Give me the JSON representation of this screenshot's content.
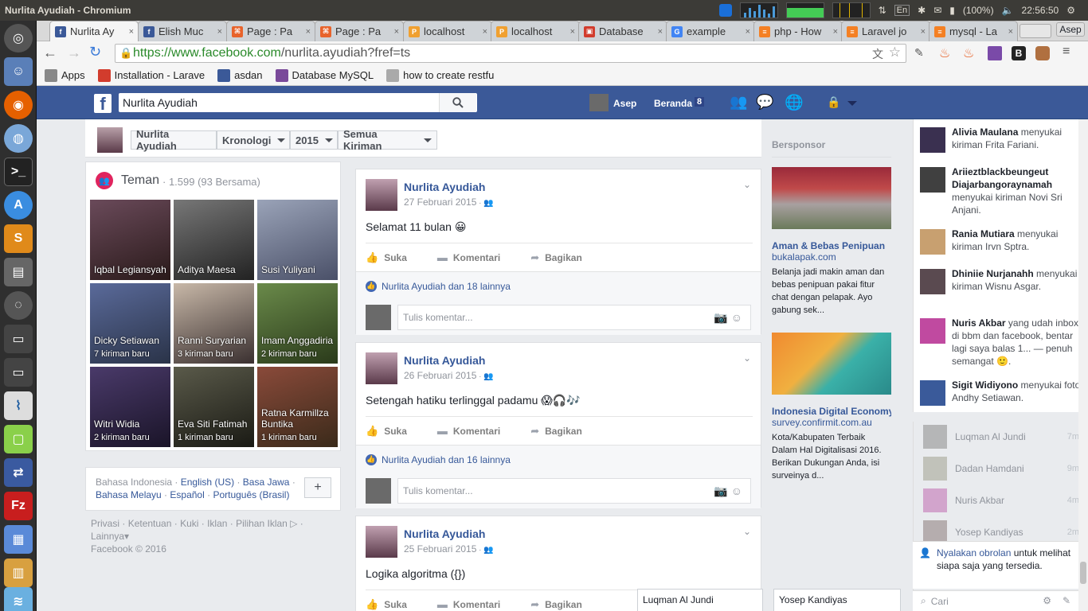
{
  "window": {
    "title": "Nurlita Ayudiah - Chromium"
  },
  "tray": {
    "battery": "(100%)",
    "clock": "22:56:50",
    "lang": "En"
  },
  "tabs": [
    {
      "label": "Nurlita Ay",
      "icon": "facebook",
      "color": "#3b5998",
      "glyph": "f"
    },
    {
      "label": "Elish Muc",
      "icon": "facebook",
      "color": "#3b5998",
      "glyph": "f"
    },
    {
      "label": "Page : Pa",
      "icon": "page",
      "color": "#e8632b",
      "glyph": "⌘"
    },
    {
      "label": "Page : Pa",
      "icon": "page",
      "color": "#e8632b",
      "glyph": "⌘"
    },
    {
      "label": "localhost",
      "icon": "phpmyadmin",
      "color": "#f0a030",
      "glyph": "P"
    },
    {
      "label": "localhost",
      "icon": "phpmyadmin",
      "color": "#f0a030",
      "glyph": "P"
    },
    {
      "label": "Database",
      "icon": "database",
      "color": "#d23c2d",
      "glyph": "▣"
    },
    {
      "label": "example",
      "icon": "google",
      "color": "#4285f4",
      "glyph": "G"
    },
    {
      "label": "php - How",
      "icon": "stackoverflow",
      "color": "#f48024",
      "glyph": "≡"
    },
    {
      "label": "Laravel jo",
      "icon": "stackoverflow",
      "color": "#f48024",
      "glyph": "≡"
    },
    {
      "label": "mysql - La",
      "icon": "stackoverflow",
      "color": "#f48024",
      "glyph": "≡"
    }
  ],
  "profile_user": "Asep",
  "url": {
    "host": "https://www.facebook.com",
    "path": "/nurlita.ayudiah?fref=ts"
  },
  "bookmarks": [
    {
      "label": "Apps",
      "icon": "apps",
      "color": "#888"
    },
    {
      "label": "Installation - Larave",
      "icon": "laravel",
      "color": "#d23c2d"
    },
    {
      "label": "asdan",
      "icon": "facebook",
      "color": "#3b5998"
    },
    {
      "label": "Database MySQL",
      "icon": "bookmark",
      "color": "#7a4a9a"
    },
    {
      "label": "how to create restfu",
      "icon": "page",
      "color": "#aaa"
    }
  ],
  "fb": {
    "search_value": "Nurlita Ayudiah",
    "user": "Asep",
    "home": "Beranda",
    "home_count": "8"
  },
  "timeline": {
    "name": "Nurlita Ayudiah",
    "kronologi": "Kronologi",
    "year": "2015",
    "filter": "Semua Kiriman"
  },
  "friends": {
    "title": "Teman",
    "count": "· 1.599 (93 Bersama)",
    "items": [
      {
        "name": "Iqbal Legiansyah",
        "sub": "",
        "c1": "#6a4a5a",
        "c2": "#2a1a1a"
      },
      {
        "name": "Aditya Maesa",
        "sub": "",
        "c1": "#777",
        "c2": "#222"
      },
      {
        "name": "Susi Yuliyani",
        "sub": "",
        "c1": "#9aa3b8",
        "c2": "#4a5068"
      },
      {
        "name": "Dicky Setiawan",
        "sub": "7 kiriman baru",
        "c1": "#5a6a9a",
        "c2": "#2a3348"
      },
      {
        "name": "Ranni Suryarian",
        "sub": "3 kiriman baru",
        "c1": "#c8b8a8",
        "c2": "#3a3030"
      },
      {
        "name": "Imam Anggadiria",
        "sub": "2 kiriman baru",
        "c1": "#6a8a4a",
        "c2": "#2a3a1a"
      },
      {
        "name": "Witri Widia",
        "sub": "2 kiriman baru",
        "c1": "#4a3a6a",
        "c2": "#1a1428"
      },
      {
        "name": "Eva Siti Fatimah",
        "sub": "1 kiriman baru",
        "c1": "#5a5a4a",
        "c2": "#1a1a14"
      },
      {
        "name": "Ratna Karmillza Buntika",
        "sub": "1 kiriman baru",
        "c1": "#8a4a3a",
        "c2": "#3a2a1a"
      }
    ]
  },
  "languages": {
    "current": "Bahasa Indonesia",
    "list": [
      "English (US)",
      "Basa Jawa",
      "Bahasa Melayu",
      "Español",
      "Português (Brasil)"
    ]
  },
  "footer": {
    "links": [
      "Privasi",
      "Ketentuan",
      "Kuki",
      "Iklan",
      "Pilihan Iklan"
    ],
    "more": "Lainnya",
    "copyright": "Facebook © 2016"
  },
  "posts": [
    {
      "author": "Nurlita Ayudiah",
      "date": "27 Februari 2015",
      "text": "Selamat 11 bulan 😀",
      "likes": "Nurlita Ayudiah dan 18 lainnya"
    },
    {
      "author": "Nurlita Ayudiah",
      "date": "26 Februari 2015",
      "text": "Setengah hatiku terlinggal padamu 😱🎧🎶",
      "likes": "Nurlita Ayudiah dan 16 lainnya"
    },
    {
      "author": "Nurlita Ayudiah",
      "date": "25 Februari 2015",
      "text": "Logika algoritma ({})",
      "likes": ""
    }
  ],
  "actions": {
    "like": "Suka",
    "comment": "Komentari",
    "share": "Bagikan",
    "comment_placeholder": "Tulis komentar..."
  },
  "sponsored": {
    "title": "Bersponsor",
    "ads": [
      {
        "title": "Aman & Bebas Penipuan",
        "url": "bukalapak.com",
        "body": "Belanja jadi makin aman dan bebas penipuan pakai fitur chat dengan pelapak. Ayo gabung sek..."
      },
      {
        "title": "Indonesia Digital Economy...",
        "url": "survey.confirmit.com.au",
        "body": "Kota/Kabupaten Terbaik Dalam Hal Digitalisasi 2016. Berikan Dukungan Anda, isi surveinya d..."
      }
    ]
  },
  "ticker": [
    {
      "name": "Alivia Maulana",
      "text": " menyukai kiriman Frita Fariani."
    },
    {
      "name": "Ariieztblackbeungeut Diajarbangoraynamah",
      "text": " menyukai kiriman Novi Sri Anjani."
    },
    {
      "name": "Rania Mutiara",
      "text": " menyukai kiriman Irvn Sptra."
    },
    {
      "name": "Dhiniie Nurjanahh",
      "text": " menyukai kiriman Wisnu Asgar."
    },
    {
      "name": "Nuris Akbar",
      "text": " yang udah inbox di bbm dan facebook, bentar lagi saya balas 1... — penuh semangat 🙂."
    },
    {
      "name": "Sigit Widiyono",
      "text": " menyukai foto Andhy Setiawan."
    }
  ],
  "chat": [
    {
      "name": "Luqman Al Jundi",
      "time": "7m"
    },
    {
      "name": "Dadan Hamdani",
      "time": "9m"
    },
    {
      "name": "Nuris Akbar",
      "time": "4m"
    },
    {
      "name": "Yosep Kandiyas",
      "time": "2m"
    }
  ],
  "chat_note": {
    "link": "Nyalakan obrolan",
    "rest": " untuk melihat siapa saja yang tersedia."
  },
  "chat_search": "Cari",
  "docked": [
    "Luqman Al Jundi",
    "Yosep Kandiyas"
  ]
}
